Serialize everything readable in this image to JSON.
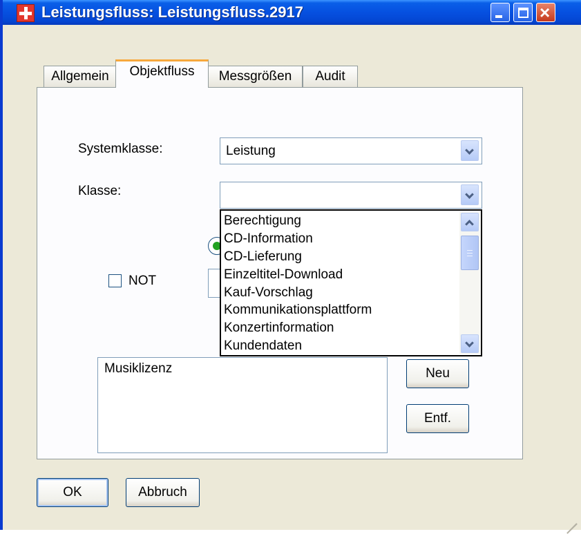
{
  "window": {
    "title": "Leistungsfluss: Leistungsfluss.2917",
    "controls": {
      "minimize": "minimize",
      "maximize": "maximize",
      "close": "×"
    }
  },
  "tabs": [
    {
      "label": "Allgemein",
      "active": false
    },
    {
      "label": "Objektfluss",
      "active": true
    },
    {
      "label": "Messgrößen",
      "active": false
    },
    {
      "label": "Audit",
      "active": false
    }
  ],
  "form": {
    "systemklasse": {
      "label": "Systemklasse:",
      "value": "Leistung"
    },
    "klasse": {
      "label": "Klasse:",
      "value": "",
      "options": [
        "Berechtigung",
        "CD-Information",
        "CD-Lieferung",
        "Einzeltitel-Download",
        "Kauf-Vorschlag",
        "Kommunikationsplattform",
        "Konzertinformation",
        "Kundendaten"
      ]
    },
    "not_checkbox": {
      "label": "NOT",
      "checked": false
    }
  },
  "listbox": {
    "items": [
      "Musiklizenz"
    ]
  },
  "buttons": {
    "neu": "Neu",
    "entf": "Entf.",
    "ok": "OK",
    "abbruch": "Abbruch"
  },
  "colors": {
    "title_bar": "#0650e0",
    "close_button": "#c5391d",
    "active_tab_accent": "#f7a83c",
    "radio_selected": "#21a121"
  }
}
